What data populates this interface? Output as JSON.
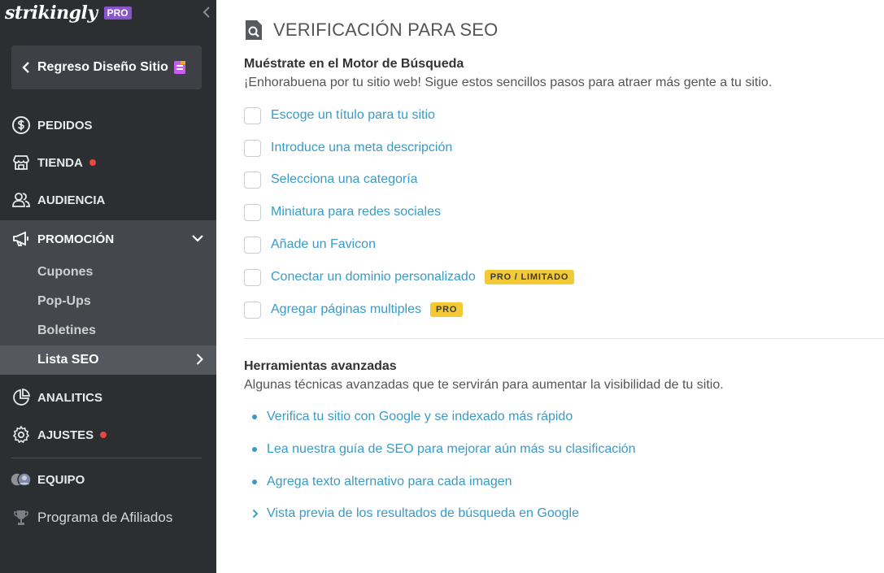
{
  "brand": {
    "logo": "strikingly",
    "badge": "PRO"
  },
  "sidebar": {
    "back_label": "Regreso Diseño Sitio",
    "items": [
      {
        "label": "PEDIDOS",
        "icon": "dollar-circle-icon"
      },
      {
        "label": "TIENDA",
        "icon": "store-icon"
      },
      {
        "label": "AUDIENCIA",
        "icon": "users-icon"
      },
      {
        "label": "PROMOCIÓN",
        "icon": "megaphone-icon"
      },
      {
        "label": "ANALITICS",
        "icon": "pie-chart-icon"
      },
      {
        "label": "AJUSTES",
        "icon": "gear-icon"
      },
      {
        "label": "EQUIPO",
        "icon": "team-avatars-icon"
      },
      {
        "label": "Programa de Afiliados",
        "icon": "trophy-icon"
      }
    ],
    "submenu": [
      {
        "label": "Cupones"
      },
      {
        "label": "Pop-Ups"
      },
      {
        "label": "Boletines"
      },
      {
        "label": "Lista SEO"
      }
    ]
  },
  "main": {
    "title": "VERIFICACIÓN PARA SEO",
    "section1": {
      "heading": "Muéstrate en el Motor de Búsqueda",
      "description": "¡Enhorabuena por tu sitio web! Sigue estos sencillos pasos para atraer más gente a tu sitio.",
      "checklist": [
        {
          "label": "Escoge un título para tu sitio"
        },
        {
          "label": "Introduce una meta descripción"
        },
        {
          "label": "Selecciona una categoría"
        },
        {
          "label": "Miniatura para redes sociales"
        },
        {
          "label": "Añade un Favicon"
        },
        {
          "label": "Conectar un dominio personalizado",
          "tag": "PRO / LIMITADO"
        },
        {
          "label": "Agregar páginas multiples",
          "tag": "PRO"
        }
      ]
    },
    "section2": {
      "heading": "Herramientas avanzadas",
      "description": "Algunas técnicas avanzadas que te servirán para aumentar la visibilidad de tu sitio.",
      "links": [
        {
          "label": "Verifica tu sitio con Google y se indexado más rápido"
        },
        {
          "label": "Lea nuestra guía de SEO para mejorar aún más su clasificación"
        },
        {
          "label": "Agrega texto alternativo para cada imagen"
        },
        {
          "label": "Vista previa de los resultados de búsqueda en Google"
        }
      ]
    }
  },
  "colors": {
    "sidebar": "#2d2e31",
    "accent_link": "#3a9bc7",
    "tag": "#f4c936",
    "pro_badge": "#8b54cf",
    "notify_dot": "#e8483f"
  }
}
